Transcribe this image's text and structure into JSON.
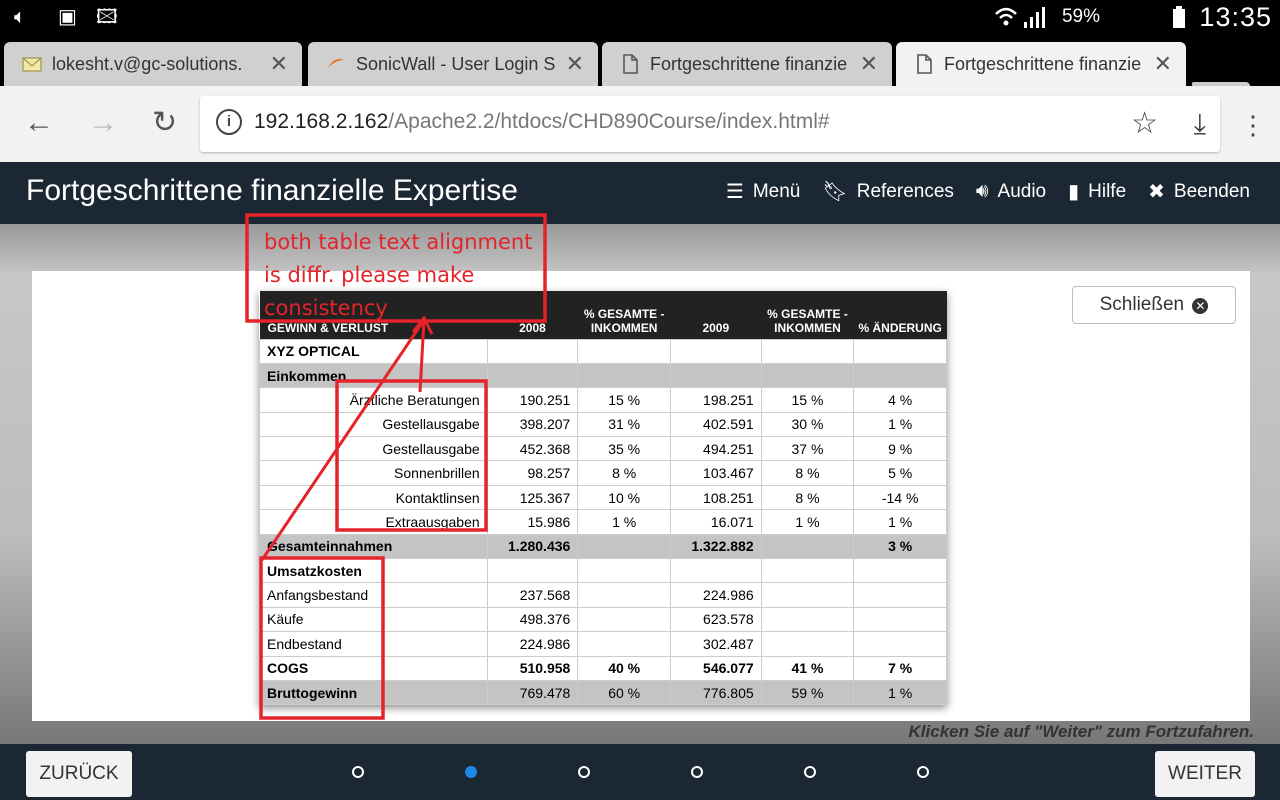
{
  "status": {
    "battery": "59%",
    "clock": "13:35"
  },
  "tabs": [
    {
      "label": "lokesht.v@gc-solutions.",
      "active": false,
      "icon": "mail-icon"
    },
    {
      "label": "SonicWall - User Login S",
      "active": false,
      "icon": "sonicwall-icon"
    },
    {
      "label": "Fortgeschrittene finanzie",
      "active": false,
      "icon": "page-icon"
    },
    {
      "label": "Fortgeschrittene finanzie",
      "active": true,
      "icon": "page-icon"
    }
  ],
  "url": {
    "host": "192.168.2.162",
    "path": "/Apache2.2/htdocs/CHD890Course/index.html#"
  },
  "app": {
    "title": "Fortgeschrittene finanzielle Expertise",
    "menu": {
      "menu": "Menü",
      "references": "References",
      "audio": "Audio",
      "help": "Hilfe",
      "exit": "Beenden"
    }
  },
  "modal": {
    "close_label": "Schließen",
    "hint": "Klicken Sie auf \"Weiter\" zum Fortzufahren."
  },
  "table": {
    "headers": [
      "GEWINN & VERLUST",
      "2008",
      "% GESAMTE -INKOMMEN",
      "2009",
      "% GESAMTE -INKOMMEN",
      "% ÄNDERUNG"
    ],
    "rows": [
      {
        "c": [
          "XYZ OPTICAL",
          "",
          "",
          "",
          "",
          ""
        ],
        "style": "bold",
        "align": "left"
      },
      {
        "c": [
          "Einkommen",
          "",
          "",
          "",
          "",
          ""
        ],
        "style": "gray-bold",
        "align": "left"
      },
      {
        "c": [
          "Ärztliche Beratungen",
          "190.251",
          "15 %",
          "198.251",
          "15 %",
          "4 %"
        ],
        "style": "",
        "align": "right"
      },
      {
        "c": [
          "Gestellausgabe",
          "398.207",
          "31 %",
          "402.591",
          "30 %",
          "1 %"
        ],
        "style": "",
        "align": "right"
      },
      {
        "c": [
          "Gestellausgabe",
          "452.368",
          "35 %",
          "494.251",
          "37 %",
          "9 %"
        ],
        "style": "",
        "align": "right"
      },
      {
        "c": [
          "Sonnenbrillen",
          "98.257",
          "8 %",
          "103.467",
          "8 %",
          "5 %"
        ],
        "style": "",
        "align": "right"
      },
      {
        "c": [
          "Kontaktlinsen",
          "125.367",
          "10 %",
          "108.251",
          "8 %",
          "-14 %"
        ],
        "style": "",
        "align": "right"
      },
      {
        "c": [
          "Extraausgaben",
          "15.986",
          "1 %",
          "16.071",
          "1 %",
          "1 %"
        ],
        "style": "",
        "align": "right"
      },
      {
        "c": [
          "Gesamteinnahmen",
          "1.280.436",
          "",
          "1.322.882",
          "",
          "3 %"
        ],
        "style": "gray-bold",
        "align": "left"
      },
      {
        "c": [
          "Umsatzkosten",
          "",
          "",
          "",
          "",
          ""
        ],
        "style": "bold",
        "align": "left"
      },
      {
        "c": [
          "Anfangsbestand",
          "237.568",
          "",
          "224.986",
          "",
          ""
        ],
        "style": "",
        "align": "left"
      },
      {
        "c": [
          "Käufe",
          "498.376",
          "",
          "623.578",
          "",
          ""
        ],
        "style": "",
        "align": "left"
      },
      {
        "c": [
          "Endbestand",
          "224.986",
          "",
          "302.487",
          "",
          ""
        ],
        "style": "",
        "align": "left"
      },
      {
        "c": [
          "COGS",
          "510.958",
          "40 %",
          "546.077",
          "41 %",
          "7 %"
        ],
        "style": "bold",
        "align": "left"
      },
      {
        "c": [
          "Bruttogewinn",
          "769.478",
          "60 %",
          "776.805",
          "59 %",
          "1 %"
        ],
        "style": "gray-bold-label",
        "align": "left"
      }
    ]
  },
  "annotation": {
    "text": "both table text alignment is diffr. please make consistency",
    "color": "#e5232a"
  },
  "footer": {
    "back": "ZURÜCK",
    "next": "WEITER",
    "dots": 6,
    "active_dot": 2
  }
}
